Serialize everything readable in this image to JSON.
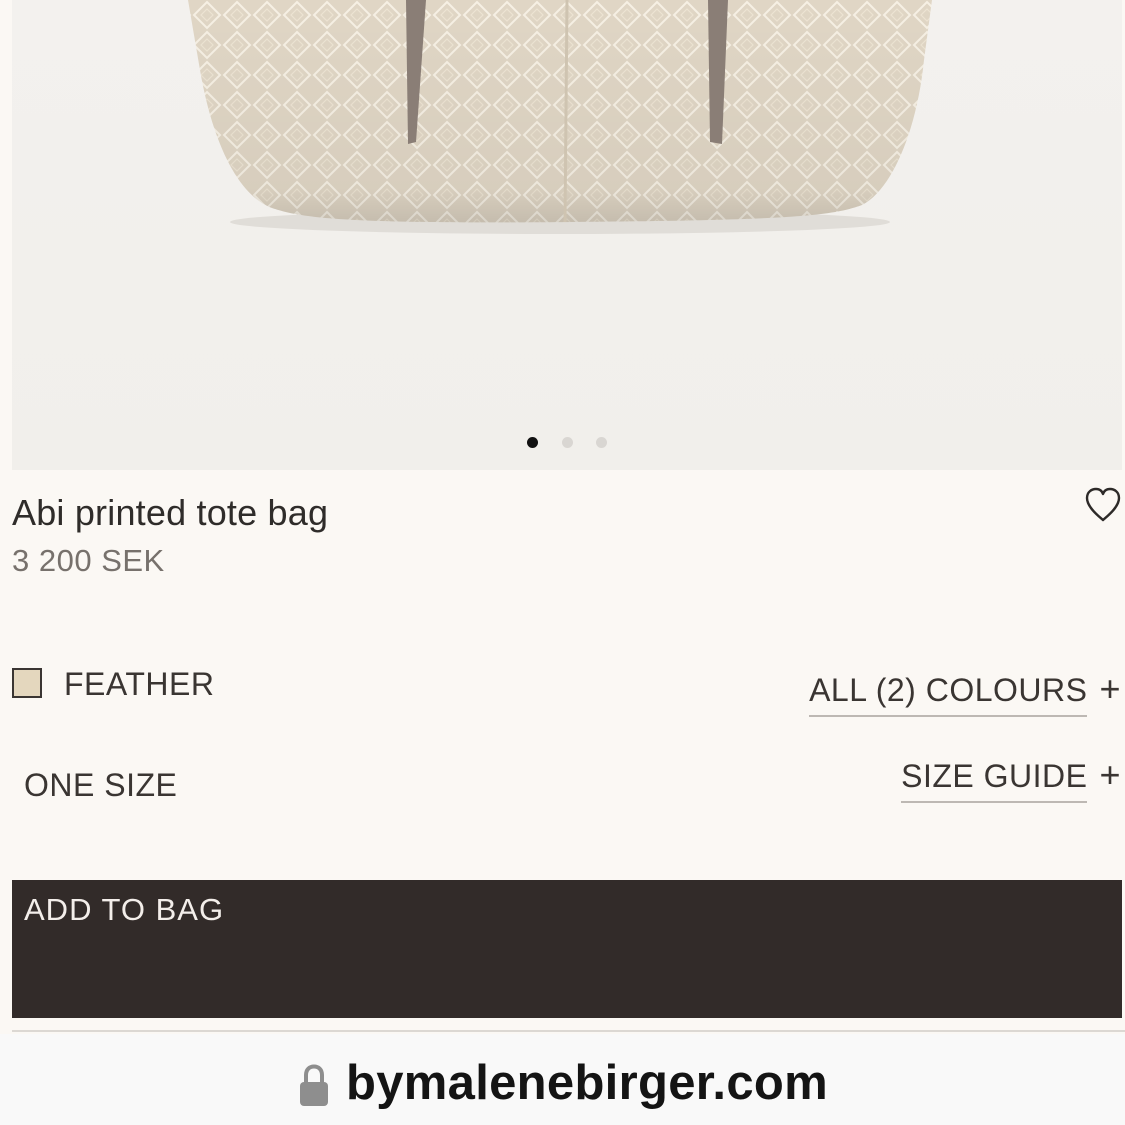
{
  "product": {
    "title": "Abi printed tote bag",
    "price": "3 200 SEK",
    "wishlist_icon": "heart-icon"
  },
  "gallery": {
    "image_count": 3,
    "active_index": 0
  },
  "colour": {
    "selected": "FEATHER",
    "swatch_color": "#e4d7be",
    "all_colours_label": "ALL (2) COLOURS",
    "expand_symbol": "+"
  },
  "size": {
    "selected": "ONE SIZE",
    "guide_label": "SIZE GUIDE",
    "expand_symbol": "+"
  },
  "cta": {
    "add_to_bag_label": "ADD TO BAG",
    "background": "#322b29"
  },
  "browser": {
    "domain": "bymalenebirger.com",
    "lock_icon": "lock-icon"
  }
}
